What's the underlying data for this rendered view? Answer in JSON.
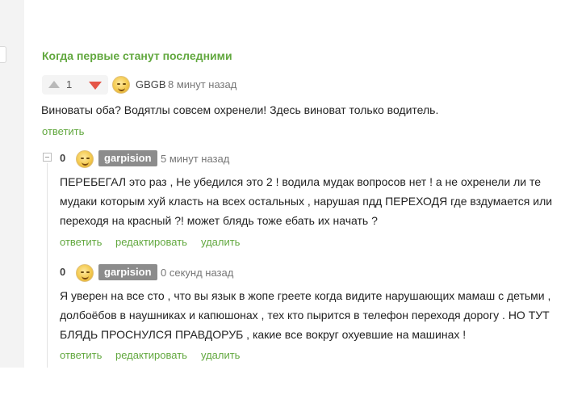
{
  "comment": {
    "title": "Когда первые станут последними",
    "votes": {
      "count": "1"
    },
    "author": "GBGB",
    "time": "8 минут назад",
    "text": "Виноваты оба? Водятлы совсем охренели! Здесь виноват только водитель.",
    "reply_label": "ответить"
  },
  "replies": [
    {
      "rating": "0",
      "author": "garpision",
      "time": "5 минут назад",
      "lines": [
        "ПЕРЕБЕГАЛ это раз , Не убедился это 2 ! водила мудак вопросов нет ! а не охренели ли те",
        "мудаки которым хуй класть на всех остальных , нарушая пдд ПЕРЕХОДЯ где вздумается или",
        "переходя на красный ?! может блядь тоже ебать их начать ?"
      ],
      "actions": {
        "reply": "ответить",
        "edit": "редактировать",
        "delete": "удалить"
      }
    },
    {
      "rating": "0",
      "author": "garpision",
      "time": "0 секунд назад",
      "lines": [
        "Я уверен на все сто , что вы язык в жопе греете когда видите нарушающих мамаш с детьми ,",
        "долбоёбов в наушниках и капюшонах , тех кто пырится в телефон переходя дорогу . НО ТУТ",
        "БЛЯДЬ ПРОСНУЛСЯ ПРАВДОРУБ , какие все вокруг охуевшие на машинах !"
      ],
      "actions": {
        "reply": "ответить",
        "edit": "редактировать",
        "delete": "удалить"
      }
    }
  ],
  "colors": {
    "link_green": "#62a83f",
    "downvote_red": "#e55547",
    "badge_gray": "#8c8c8c"
  },
  "icons": {
    "upvote": "triangle-up-icon",
    "downvote": "triangle-down-icon",
    "collapse": "minus-box-icon",
    "avatar": "smiley-avatar"
  }
}
